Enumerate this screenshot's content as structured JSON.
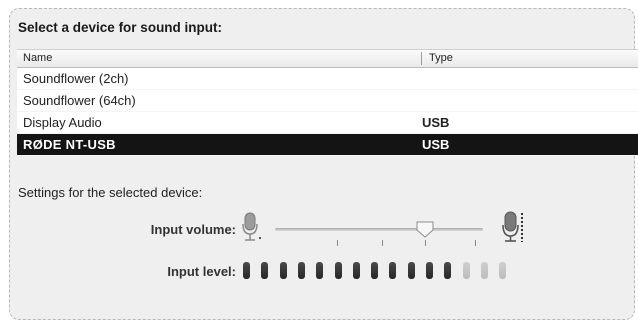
{
  "heading": "Select a device for sound input:",
  "table": {
    "columns": {
      "name": "Name",
      "type": "Type"
    },
    "rows": [
      {
        "name": "Soundflower (2ch)",
        "type": ""
      },
      {
        "name": "Soundflower (64ch)",
        "type": ""
      },
      {
        "name": "Display Audio",
        "type": "USB"
      },
      {
        "name": "RØDE NT-USB",
        "type": "USB",
        "selected": true
      }
    ]
  },
  "settings_label": "Settings for the selected device:",
  "input_volume": {
    "label": "Input volume:",
    "value": 0.72
  },
  "input_level": {
    "label": "Input level:",
    "segments": 15,
    "active": 12
  },
  "icons": {
    "volume_low": "microphone-low-icon",
    "volume_high": "microphone-high-icon"
  },
  "colors": {
    "selected_row_bg": "#141414",
    "selected_row_text": "#ffffff",
    "level_on": "#2e2e2e",
    "level_off": "#c6c6c6"
  }
}
